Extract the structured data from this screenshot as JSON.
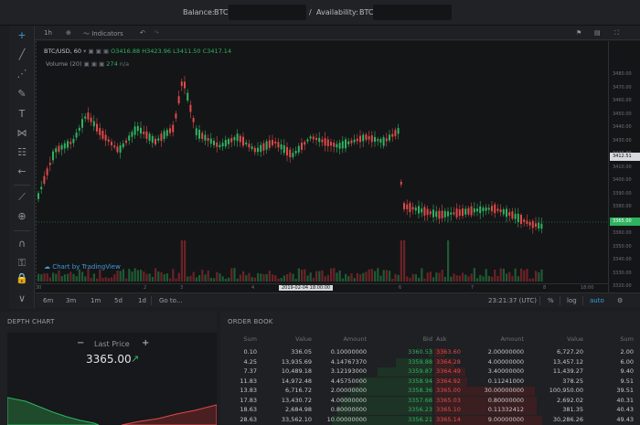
{
  "topbar": {
    "balance_label": "Balance:",
    "balance_currency": "BTC",
    "separator": "/",
    "availability_label": "Availability:",
    "availability_currency": "BTC"
  },
  "chart_toolbar": {
    "interval": "1h",
    "indicators": "Indicators"
  },
  "legend": {
    "symbol": "BTC/USD, 60",
    "open": "O3416.88",
    "high": "H3423.96",
    "low": "L3411.50",
    "close": "C3417.14",
    "volume_label": "Volume (20)",
    "volume_value": "274",
    "volume_na": "n/a"
  },
  "price_scale": {
    "ticks": [
      "3480.00",
      "3470.00",
      "3460.00",
      "3450.00",
      "3440.00",
      "3430.00",
      "3420.00",
      "3410.00",
      "3400.00",
      "3390.00",
      "3380.00",
      "3370.00",
      "3360.00",
      "3350.00",
      "3340.00",
      "3330.00",
      "3320.00"
    ],
    "current_high": "3412.51",
    "last_price": "3365.00"
  },
  "time_scale": {
    "labels": [
      "30",
      "2",
      "3",
      "4",
      "2019-02-04 18:00:00",
      "6",
      "7",
      "8",
      "18:00"
    ]
  },
  "watermark": "Chart by TradingView",
  "range_bar": {
    "ranges": [
      "6m",
      "3m",
      "1m",
      "5d",
      "1d"
    ],
    "goto": "Go to...",
    "clock": "23:21:37 (UTC)",
    "percent": "%",
    "log": "log",
    "auto": "auto"
  },
  "depth_chart": {
    "title": "DEPTH CHART",
    "minus": "−",
    "plus": "+",
    "last_price_label": "Last Price",
    "last_price": "3365.00",
    "arrow": "↗"
  },
  "order_book": {
    "title": "ORDER BOOK",
    "headers": [
      "Sum",
      "Value",
      "Amount",
      "Bid",
      "Ask",
      "Amount",
      "Value",
      "Sum"
    ],
    "rows": [
      {
        "bsum": "0.10",
        "bval": "336.05",
        "bamt": "0.10000000",
        "bid": "3360.53",
        "ask": "3363.60",
        "aamt": "2.00000000",
        "aval": "6,727.20",
        "asum": "2.00"
      },
      {
        "bsum": "4.25",
        "bval": "13,935.69",
        "bamt": "4.14767370",
        "bid": "3359.88",
        "ask": "3364.28",
        "aamt": "4.00000000",
        "aval": "13,457.12",
        "asum": "6.00"
      },
      {
        "bsum": "7.37",
        "bval": "10,489.18",
        "bamt": "3.12193000",
        "bid": "3359.87",
        "ask": "3364.49",
        "aamt": "3.40000000",
        "aval": "11,439.27",
        "asum": "9.40"
      },
      {
        "bsum": "11.83",
        "bval": "14,972.48",
        "bamt": "4.45750000",
        "bid": "3358.94",
        "ask": "3364.92",
        "aamt": "0.11241000",
        "aval": "378.25",
        "asum": "9.51"
      },
      {
        "bsum": "13.83",
        "bval": "6,716.72",
        "bamt": "2.00000000",
        "bid": "3358.36",
        "ask": "3365.00",
        "aamt": "30.00000000",
        "aval": "100,950.00",
        "asum": "39.51"
      },
      {
        "bsum": "17.83",
        "bval": "13,430.72",
        "bamt": "4.00000000",
        "bid": "3357.68",
        "ask": "3365.03",
        "aamt": "0.80000000",
        "aval": "2,692.02",
        "asum": "40.31"
      },
      {
        "bsum": "18.63",
        "bval": "2,684.98",
        "bamt": "0.80000000",
        "bid": "3356.23",
        "ask": "3365.10",
        "aamt": "0.11332412",
        "aval": "381.35",
        "asum": "40.43"
      },
      {
        "bsum": "28.63",
        "bval": "33,562.10",
        "bamt": "10.00000000",
        "bid": "3356.21",
        "ask": "3365.14",
        "aamt": "9.00000000",
        "aval": "30,286.26",
        "asum": "49.43"
      }
    ]
  },
  "colors": {
    "bull": "#2fb360",
    "bear": "#e04a4a",
    "accent": "#3d9bd9"
  }
}
